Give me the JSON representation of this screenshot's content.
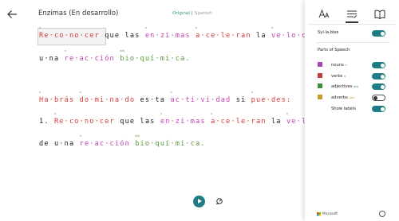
{
  "header": {
    "title": "Enzimas (En desarrollo)",
    "lang_original": "Original",
    "lang_separator": "|",
    "lang_spanish": "Spanish"
  },
  "reader": {
    "line1": {
      "w1": "Re·co·no·cer",
      "w2": "que",
      "w3": "las",
      "w4": "en·zi·mas",
      "w5": "a·ce·le·ran",
      "w6": "la",
      "w7": "ve·lo·ci",
      "tag_v": "v",
      "tag_n": "n"
    },
    "line2": {
      "w1": "u·na",
      "w2": "re·ac·ción",
      "w3": "bio·quí·mi·ca.",
      "tag_n": "n",
      "tag_adj": "adj"
    },
    "line3": {
      "w1": "Ha·brás",
      "w2": "do·mi·na·do",
      "w3": "es·ta",
      "w4": "ac·ti·vi·dad",
      "w5": "si",
      "w6": "pue·des:",
      "tag_v": "v",
      "tag_n": "n"
    },
    "line4": {
      "num": "1.",
      "w1": "Re·co·no·cer",
      "w2": "que",
      "w3": "las",
      "w4": "en·zi·mas",
      "w5": "a·ce·le·ran",
      "w6": "la",
      "w7": "ve·lo",
      "tag_v": "v",
      "tag_n": "n"
    },
    "line5": {
      "w1": "de",
      "w2": "u·na",
      "w3": "re·ac·ción",
      "w4": "bio·quí·mi·ca.",
      "tag_n": "n",
      "tag_adj": "adj"
    }
  },
  "panel": {
    "syllables_label": "Syl·la·bles",
    "parts_heading": "Parts of Speech",
    "items": [
      {
        "label": "nouns",
        "abbr": "n",
        "color": "#a844b8"
      },
      {
        "label": "verbs",
        "abbr": "v",
        "color": "#c43d3d"
      },
      {
        "label": "adjectives",
        "abbr": "adj",
        "color": "#3f8f3a"
      },
      {
        "label": "adverbs",
        "abbr": "adv",
        "color": "#c89a2b"
      }
    ],
    "show_labels": "Show labels",
    "toggles": {
      "syllables": "on",
      "nouns": "on",
      "verbs": "on",
      "adjectives": "on",
      "adverbs": "off",
      "show_labels": "on"
    }
  },
  "footer": {
    "brand": "Microsoft"
  },
  "icons": [
    "back-arrow-icon",
    "text-options-icon",
    "grammar-options-icon",
    "reading-preferences-icon",
    "play-icon",
    "voice-settings-icon",
    "info-icon",
    "microsoft-logo-icon"
  ]
}
